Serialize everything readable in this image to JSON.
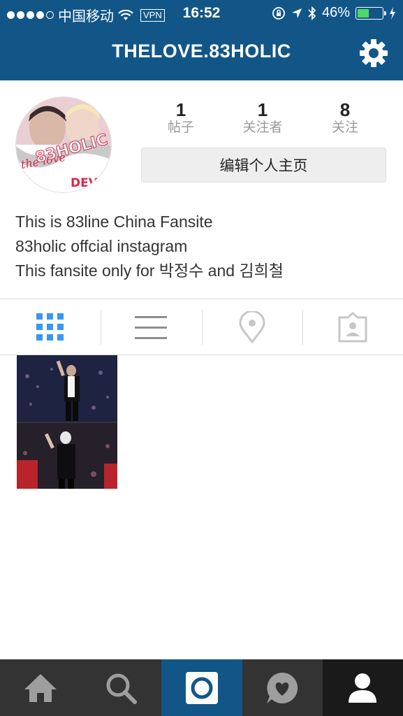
{
  "status_bar": {
    "carrier": "中国移动",
    "vpn": "VPN",
    "time": "16:52",
    "battery": "46%",
    "battery_level": 0.46
  },
  "header": {
    "title": "THELOVE.83HOLIC"
  },
  "profile": {
    "stats": [
      {
        "count": "1",
        "label": "帖子"
      },
      {
        "count": "1",
        "label": "关注者"
      },
      {
        "count": "8",
        "label": "关注"
      }
    ],
    "edit_button": "编辑个人主页",
    "avatar_text": {
      "line1": "the love",
      "line2": "83HOLIC",
      "line3": "DEVIL"
    },
    "bio": [
      "This is 83line China Fansite",
      "83holic offcial instagram",
      "This fansite only for 박정수 and 김희철"
    ]
  },
  "view_tabs": [
    "grid-view",
    "list-view",
    "location-view",
    "tagged-view"
  ],
  "colors": {
    "brand_blue": "#125688",
    "active_tab": "#3897f0",
    "nav_bg": "#333333"
  }
}
